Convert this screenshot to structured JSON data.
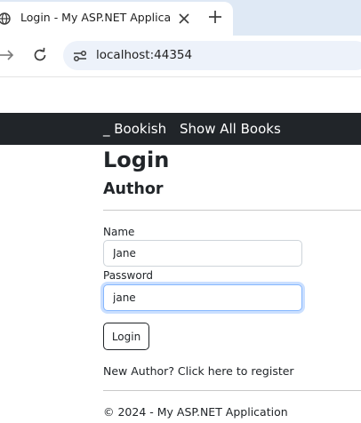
{
  "browser": {
    "tab_title": "Login - My ASP.NET Application",
    "url": "localhost:44354"
  },
  "navbar": {
    "brand": "_ Bookish",
    "links": [
      "Show All Books"
    ]
  },
  "page": {
    "heading": "Login",
    "subheading": "Author"
  },
  "form": {
    "name_label": "Name",
    "name_value": "Jane",
    "password_label": "Password",
    "password_value": "jane",
    "submit_label": "Login"
  },
  "register_link": "New Author? Click here to register",
  "footer": "© 2024 - My ASP.NET Application",
  "colors": {
    "navbar_bg": "#212529",
    "tabbar_bg": "#dfe9f5",
    "omnibox_bg": "#edf2fa",
    "focus_ring": "#86b7fe"
  }
}
